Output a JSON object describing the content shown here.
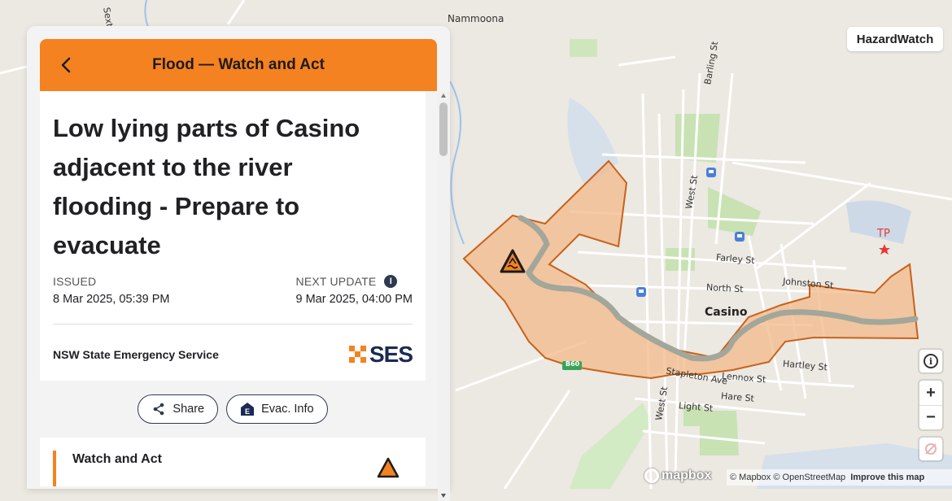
{
  "map": {
    "brand": "HazardWatch",
    "place_labels": [
      {
        "key": "nammoona",
        "text": "Nammoona"
      },
      {
        "key": "casino",
        "text": "Casino"
      },
      {
        "key": "tp",
        "text": "TP"
      }
    ],
    "street_labels": [
      "Sexton",
      "Barling St",
      "West St",
      "Farley St",
      "North St",
      "Johnston St",
      "Hartley St",
      "Lennox St",
      "Stapleton Ave",
      "Hare St",
      "Light St",
      "West St"
    ],
    "road_shield": "B60",
    "attribution": {
      "mapbox": "© Mapbox",
      "osm": "© OpenStreetMap",
      "improve": "Improve this map"
    },
    "logo": "mapbox",
    "controls": {
      "info": "i",
      "zoom_in": "+",
      "zoom_out": "−"
    },
    "colors": {
      "flood_fill": "#f2b98a",
      "flood_stroke": "#c8621a",
      "river": "#a3a69a"
    }
  },
  "panel": {
    "header_title": "Flood — Watch and Act",
    "alert_title": "Low lying parts of Casino adjacent to the river flooding - Prepare to evacuate",
    "issued_label": "ISSUED",
    "issued_value": "8 Mar 2025, 05:39 PM",
    "next_update_label": "NEXT UPDATE",
    "next_update_value": "9 Mar 2025, 04:00 PM",
    "agency": "NSW State Emergency Service",
    "agency_logo": "SES",
    "share_label": "Share",
    "evac_label": "Evac. Info",
    "section_title": "Watch and Act",
    "accent": "#f58220"
  }
}
